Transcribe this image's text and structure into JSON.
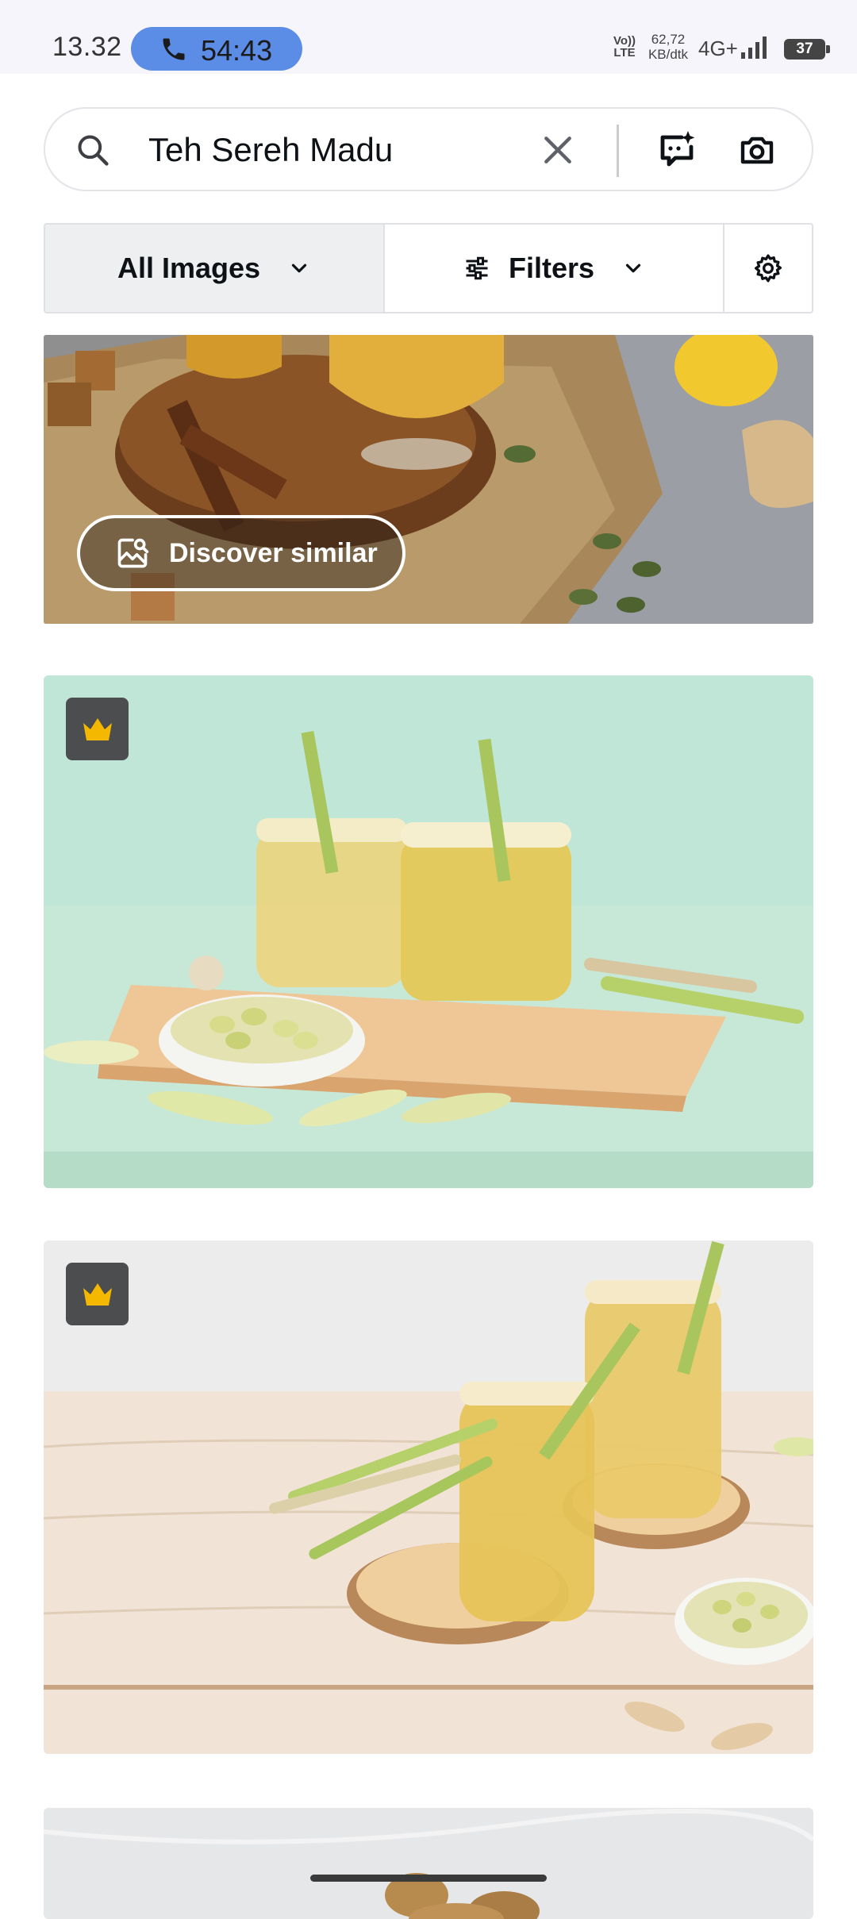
{
  "status_bar": {
    "time": "13.32",
    "call_timer": "54:43",
    "volte": "Vo)) LTE",
    "speed_value": "62,72",
    "speed_unit": "KB/dtk",
    "network": "4G+",
    "battery": "37"
  },
  "search": {
    "query": "Teh Sereh Madu",
    "icons": [
      "search-icon",
      "clear-icon",
      "ai-chat-icon",
      "camera-icon"
    ]
  },
  "filters": {
    "type_label": "All Images",
    "filters_label": "Filters",
    "settings_icon": "gear-icon"
  },
  "results": {
    "discover_similar_label": "Discover similar",
    "premium_icon": "crown-icon",
    "premium_color": "#f5b800"
  },
  "colors": {
    "call_pill": "#5b8ce6",
    "status_bar_bg": "#f5f5fb"
  }
}
